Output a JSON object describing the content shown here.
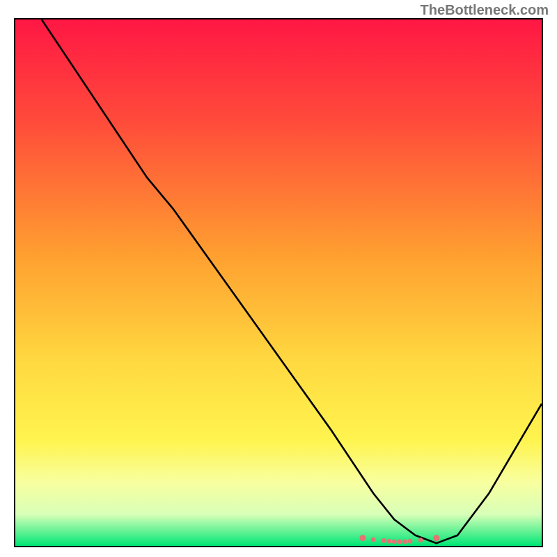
{
  "attribution": "TheBottleneck.com",
  "chart_data": {
    "type": "line",
    "title": "",
    "xlabel": "",
    "ylabel": "",
    "xlim": [
      0,
      100
    ],
    "ylim": [
      0,
      100
    ],
    "gradient_stops": [
      {
        "offset": 0,
        "color": "#ff1744"
      },
      {
        "offset": 20,
        "color": "#ff4d3a"
      },
      {
        "offset": 45,
        "color": "#ffa030"
      },
      {
        "offset": 65,
        "color": "#ffd940"
      },
      {
        "offset": 80,
        "color": "#fff44f"
      },
      {
        "offset": 88,
        "color": "#f8ffa0"
      },
      {
        "offset": 94,
        "color": "#d8ffb8"
      },
      {
        "offset": 100,
        "color": "#00e676"
      }
    ],
    "series": [
      {
        "name": "bottleneck-curve",
        "x": [
          5,
          15,
          25,
          30,
          40,
          50,
          60,
          68,
          72,
          76,
          80,
          84,
          90,
          100
        ],
        "values": [
          100,
          85,
          70,
          64,
          50,
          36,
          22,
          10,
          5,
          2,
          0.5,
          2,
          10,
          27
        ]
      }
    ],
    "markers": {
      "name": "highlight-points",
      "color": "#e57373",
      "x": [
        66,
        68,
        70,
        71,
        72,
        73,
        74,
        75,
        77,
        80
      ],
      "values": [
        1.5,
        1.2,
        1.0,
        0.9,
        0.8,
        0.8,
        0.8,
        0.9,
        1.1,
        1.5
      ]
    }
  }
}
